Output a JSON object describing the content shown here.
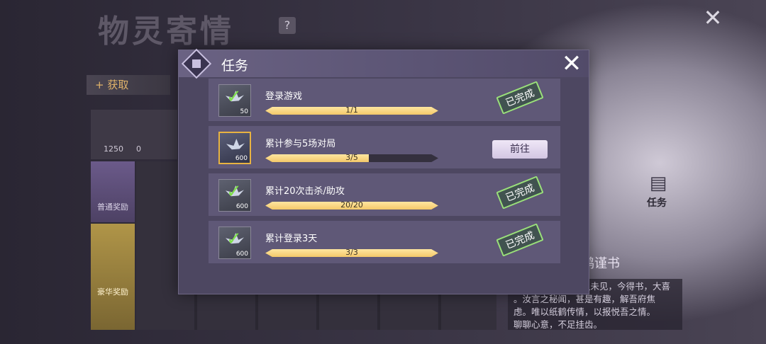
{
  "background": {
    "title": "物灵寄情",
    "help": "?",
    "close": "✕",
    "acquire_label": "+ 获取",
    "crane_count": "1250",
    "progress_start": "0",
    "normal_reward": "普通奖励",
    "luxury_reward": "豪华奖励",
    "task_label": "任务",
    "story_title": "鹊谨书",
    "story_lines": [
      "久未见，今得书，大喜",
      "。汝言之秘闻，甚是有趣，解吾府焦",
      "虑。唯以纸鹤传情，以报悦吾之情。",
      "聊聊心意，不足挂齿。"
    ]
  },
  "modal": {
    "title": "任务",
    "close": "✕",
    "tasks": [
      {
        "name": "登录游戏",
        "progress_text": "1/1",
        "progress": 1.0,
        "reward_count": "50",
        "status": "已完成",
        "completed": true
      },
      {
        "name": "累计参与5场对局",
        "progress_text": "3/5",
        "progress": 0.6,
        "reward_count": "600",
        "button": "前往",
        "completed": false
      },
      {
        "name": "累计20次击杀/助攻",
        "progress_text": "20/20",
        "progress": 1.0,
        "reward_count": "600",
        "status": "已完成",
        "completed": true
      },
      {
        "name": "累计登录3天",
        "progress_text": "3/3",
        "progress": 1.0,
        "reward_count": "600",
        "status": "已完成",
        "completed": true
      }
    ]
  },
  "colors": {
    "modal_bg": "#4d4761",
    "row_bg": "#5f5877",
    "bar_fill": "#f3c86a",
    "stamp_green": "#9ae07a"
  }
}
